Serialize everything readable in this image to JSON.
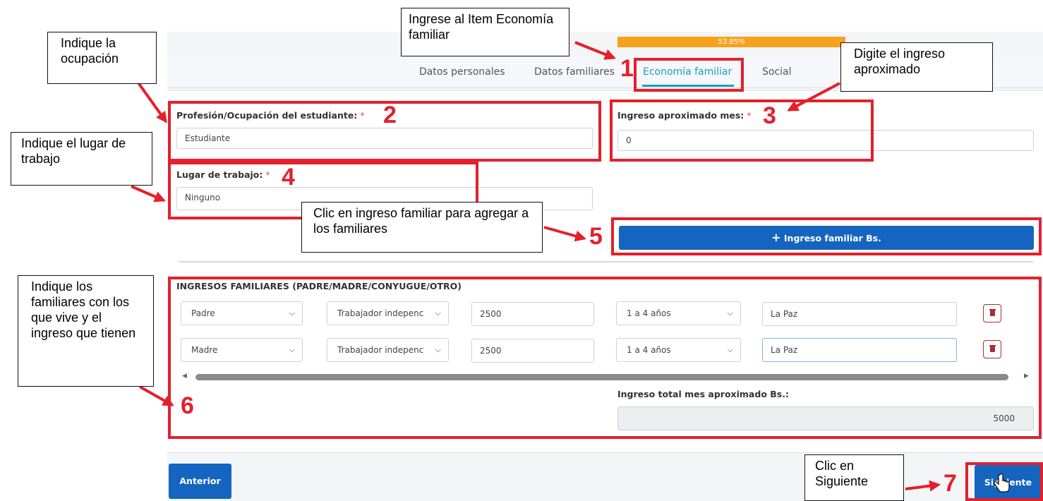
{
  "progress": {
    "label": "53.85%",
    "value_percent": 53.85
  },
  "tabs": [
    {
      "label": "Datos personales",
      "active": false
    },
    {
      "label": "Datos familiares",
      "active": false
    },
    {
      "label": "Economía familiar",
      "active": true
    },
    {
      "label": "Social",
      "active": false
    }
  ],
  "form": {
    "occupation": {
      "label": "Profesión/Ocupación del estudiante:",
      "required_mark": "*",
      "value": "Estudiante"
    },
    "income": {
      "label": "Ingreso aproximado mes:",
      "required_mark": "*",
      "value": "0"
    },
    "workplace": {
      "label": "Lugar de trabajo:",
      "required_mark": "*",
      "value": "Ninguno"
    },
    "add_income_button": {
      "icon": "plus-icon",
      "label": "Ingreso familiar Bs."
    }
  },
  "family_income": {
    "title": "INGRESOS FAMILIARES (PADRE/MADRE/CONYUGUE/OTRO)",
    "rows": [
      {
        "relation": "Padre",
        "occupation": "Trabajador indepenc",
        "amount": "2500",
        "duration": "1 a 4 años",
        "city": "La Paz"
      },
      {
        "relation": "Madre",
        "occupation": "Trabajador indepenc",
        "amount": "2500",
        "duration": "1 a 4 años",
        "city": "La Paz"
      }
    ],
    "total_label": "Ingreso total mes aproximado Bs.:",
    "total_value": "5000"
  },
  "nav": {
    "previous": "Anterior",
    "next": "Siguiente"
  },
  "annotations": {
    "callouts": [
      "Ingrese al Item Economía familiar",
      "Indique la ocupación",
      "Digite el ingreso aproximado",
      "Indique el lugar de trabajo",
      "Clic en ingreso familiar para agregar a los familiares",
      "Indique los familiares con los que vive y el ingreso que tienen",
      "Clic en Siguiente"
    ],
    "numbers": [
      "1",
      "2",
      "3",
      "4",
      "5",
      "6",
      "7"
    ]
  },
  "colors": {
    "accent": "#16a2b8",
    "primary_button": "#1565c0",
    "progress": "#f7a21c",
    "annotation_red": "#e3202c",
    "required": "#d9534f",
    "delete": "#b02a37"
  }
}
